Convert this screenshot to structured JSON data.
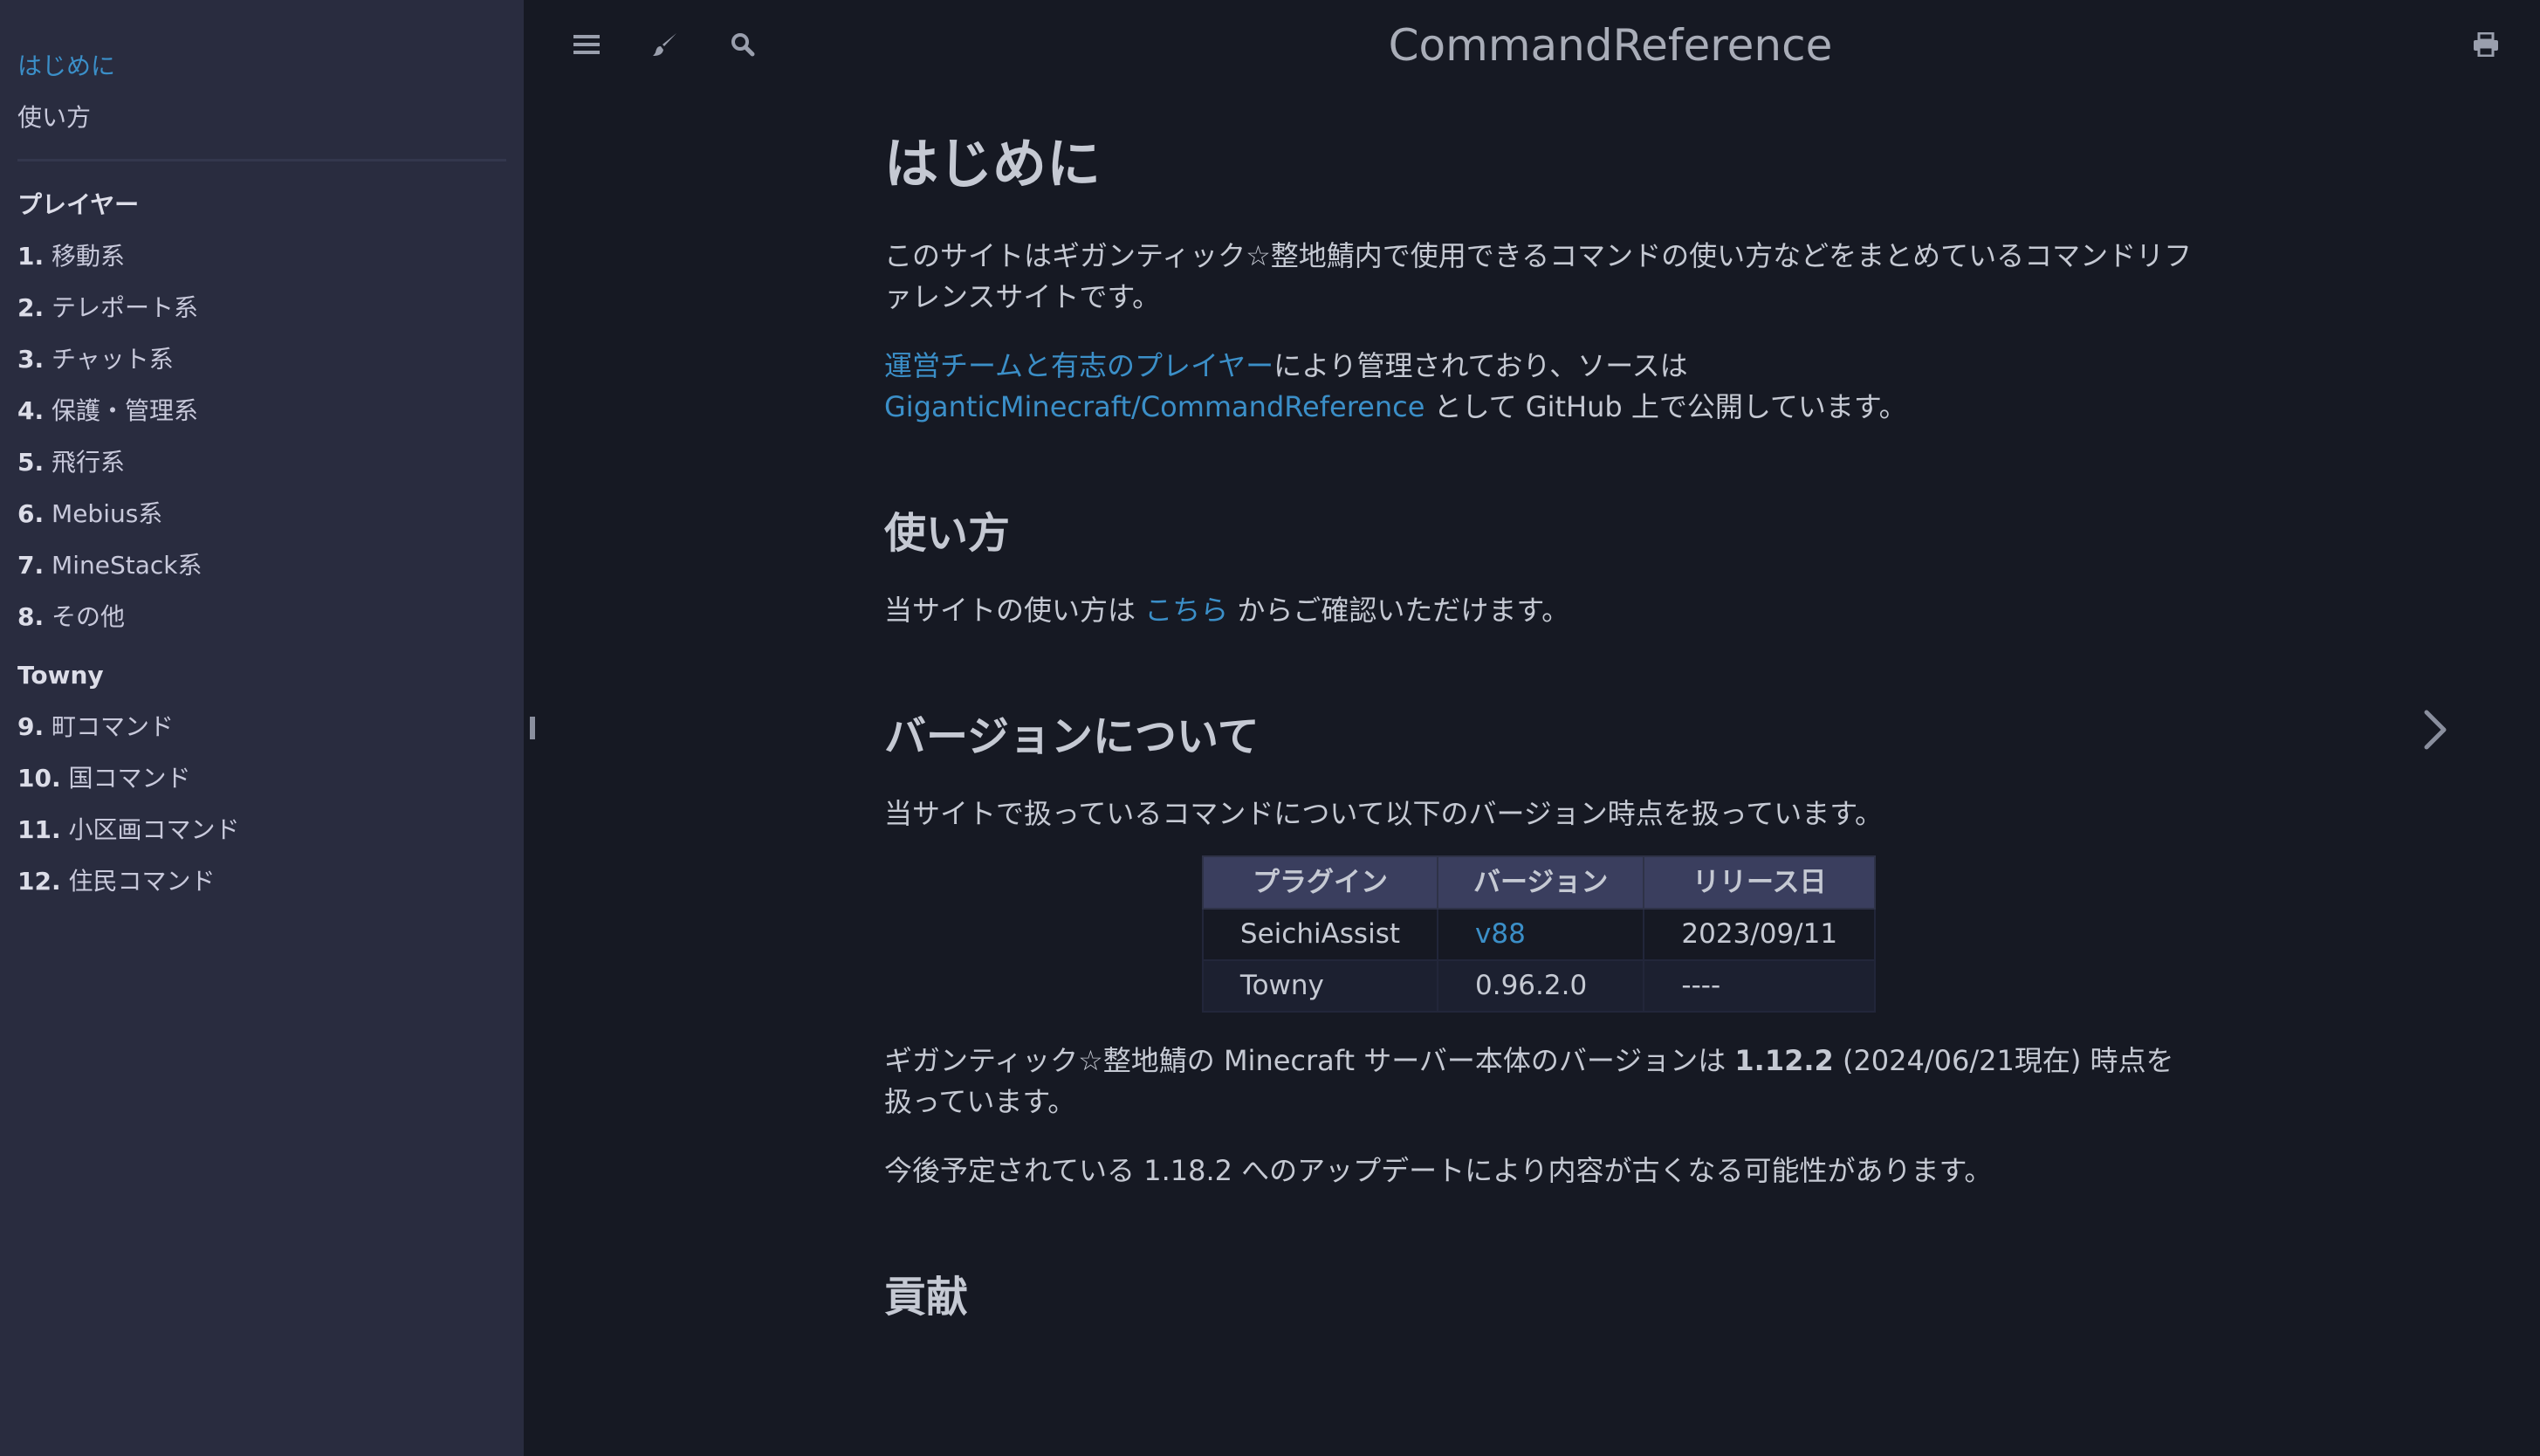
{
  "sidebar": {
    "intro": "はじめに",
    "usage": "使い方",
    "part1_title": "プレイヤー",
    "part1_items": [
      {
        "num": "1.",
        "label": "移動系"
      },
      {
        "num": "2.",
        "label": "テレポート系"
      },
      {
        "num": "3.",
        "label": "チャット系"
      },
      {
        "num": "4.",
        "label": "保護・管理系"
      },
      {
        "num": "5.",
        "label": "飛行系"
      },
      {
        "num": "6.",
        "label": "Mebius系"
      },
      {
        "num": "7.",
        "label": "MineStack系"
      },
      {
        "num": "8.",
        "label": "その他"
      }
    ],
    "part2_title": "Towny",
    "part2_items": [
      {
        "num": "9.",
        "label": "町コマンド"
      },
      {
        "num": "10.",
        "label": "国コマンド"
      },
      {
        "num": "11.",
        "label": "小区画コマンド"
      },
      {
        "num": "12.",
        "label": "住民コマンド"
      }
    ]
  },
  "header": {
    "title": "CommandReference",
    "icons": [
      "menu-icon",
      "brush-icon",
      "search-icon",
      "print-icon"
    ]
  },
  "content": {
    "h1": "はじめに",
    "p1": "このサイトはギガンティック☆整地鯖内で使用できるコマンドの使い方などをまとめているコマンドリファレンスサイトです。",
    "p2_link1": "運営チームと有志のプレイヤー",
    "p2_text1": "により管理されており、ソースは ",
    "p2_link2": "GiganticMinecraft/CommandReference",
    "p2_text2": " として GitHub 上で公開しています。",
    "h2_usage": "使い方",
    "usage_text1": "当サイトの使い方は ",
    "usage_link": "こちら",
    "usage_text2": " からご確認いただけます。",
    "h2_version": "バージョンについて",
    "version_intro": "当サイトで扱っているコマンドについて以下のバージョン時点を扱っています。",
    "table": {
      "headers": [
        "プラグイン",
        "バージョン",
        "リリース日"
      ],
      "rows": [
        {
          "plugin": "SeichiAssist",
          "version": "v88",
          "date": "2023/09/11"
        },
        {
          "plugin": "Towny",
          "version": "0.96.2.0",
          "date": "----"
        }
      ]
    },
    "server_text1": "ギガンティック☆整地鯖の Minecraft サーバー本体のバージョンは ",
    "server_version": "1.12.2",
    "server_text2": " (2024/06/21現在) 時点を扱っています。",
    "update_text": "今後予定されている 1.18.2 へのアップデートにより内容が古くなる可能性があります。",
    "h2_contrib": "貢献"
  },
  "colors": {
    "background": "#161923",
    "sidebar": "#292c3f",
    "link": "#3b8fc8",
    "text": "#c5c9d3"
  }
}
